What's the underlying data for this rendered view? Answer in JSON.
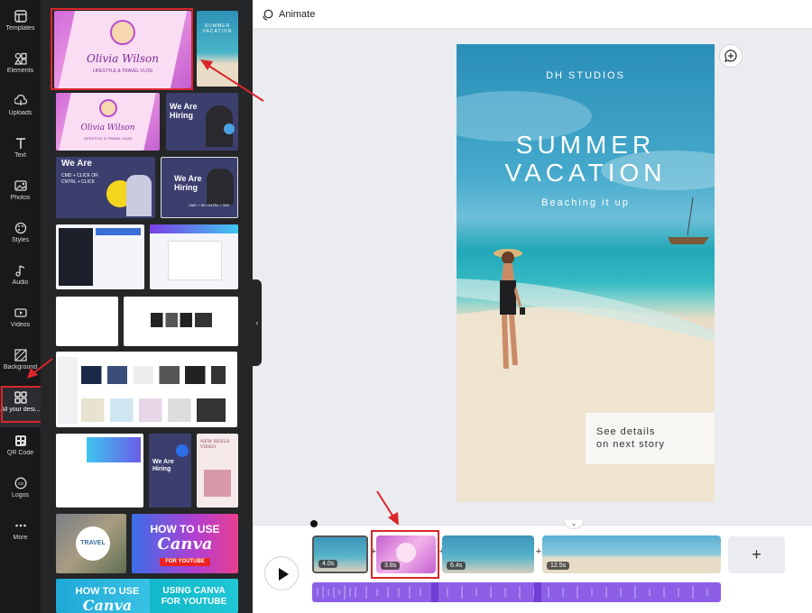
{
  "sidebar": {
    "items": [
      {
        "label": "Templates",
        "icon": "templates-icon"
      },
      {
        "label": "Elements",
        "icon": "elements-icon"
      },
      {
        "label": "Uploads",
        "icon": "uploads-icon"
      },
      {
        "label": "Text",
        "icon": "text-icon"
      },
      {
        "label": "Photos",
        "icon": "photos-icon"
      },
      {
        "label": "Styles",
        "icon": "styles-icon"
      },
      {
        "label": "Audio",
        "icon": "audio-icon"
      },
      {
        "label": "Videos",
        "icon": "videos-icon"
      },
      {
        "label": "Background",
        "icon": "background-icon"
      },
      {
        "label": "All your desi...",
        "icon": "grid-icon"
      },
      {
        "label": "QR Code",
        "icon": "qr-code-icon"
      },
      {
        "label": "Logos",
        "icon": "logos-icon"
      },
      {
        "label": "More",
        "icon": "more-icon"
      }
    ]
  },
  "panel": {
    "thumb1": {
      "name": "Olivia Wilson",
      "sub": "LIFESTYLE & TRAVEL VLOG"
    },
    "thumb2": {
      "title": "SUMMER VACATION"
    },
    "thumb3": {
      "name": "Olivia Wilson",
      "sub": "LIFESTYLE & TRAVEL VLOG"
    },
    "thumb4": {
      "title": "We Are Hiring"
    },
    "thumb5": {
      "title": "We Are",
      "sub": "CMD + CLICK OR CNTRL + CLICK"
    },
    "thumb6": {
      "title": "We Are Hiring",
      "sub": "CMD + SH CNTRL + SHI"
    },
    "thumb14": {
      "title": "We Are Hiring"
    },
    "thumb15": {
      "title": "NEW REELS VIDEO"
    },
    "thumb16": {
      "badge": "TRAVEL"
    },
    "thumb17": {
      "line1": "HOW TO USE",
      "line2": "Canva",
      "tag": "FOR YOUTUBE"
    },
    "thumb18": {
      "line1": "HOW TO USE",
      "line2": "Canva"
    },
    "thumb19": {
      "line1": "USING CANVA",
      "line2": "FOR YOUTUBE"
    }
  },
  "topbar": {
    "animate_label": "Animate"
  },
  "canvas": {
    "studio": "DH STUDIOS",
    "title_line1": "SUMMER",
    "title_line2": "VACATION",
    "subtitle": "Beaching it up",
    "details_line1": "See details",
    "details_line2": "on next story"
  },
  "timeline": {
    "clips": [
      {
        "duration": "4.0s"
      },
      {
        "duration": "3.8s"
      },
      {
        "duration": "6.4s"
      },
      {
        "duration": "12.5s"
      }
    ],
    "add_page": "+"
  },
  "colors": {
    "highlight": "#d9262b",
    "accent": "#8b3dff"
  }
}
